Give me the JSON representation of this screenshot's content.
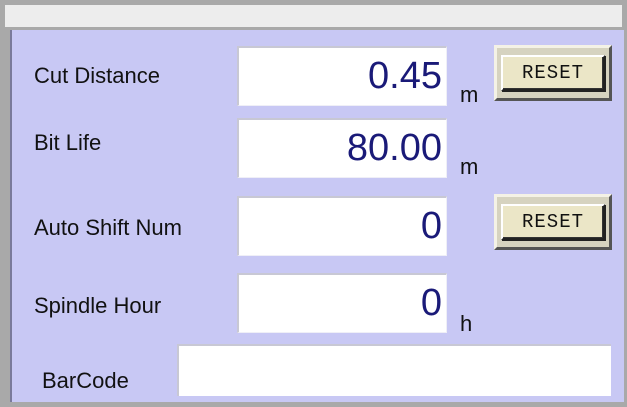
{
  "fields": [
    {
      "label": "Cut Distance",
      "value": "0.45",
      "unit": "m",
      "reset": "RESET"
    },
    {
      "label": "Bit Life",
      "value": "80.00",
      "unit": "m"
    },
    {
      "label": "Auto Shift Num",
      "value": "0",
      "reset": "RESET"
    },
    {
      "label": "Spindle Hour",
      "value": "0",
      "unit": "h"
    }
  ],
  "barcode": {
    "label": "BarCode",
    "value": ""
  }
}
